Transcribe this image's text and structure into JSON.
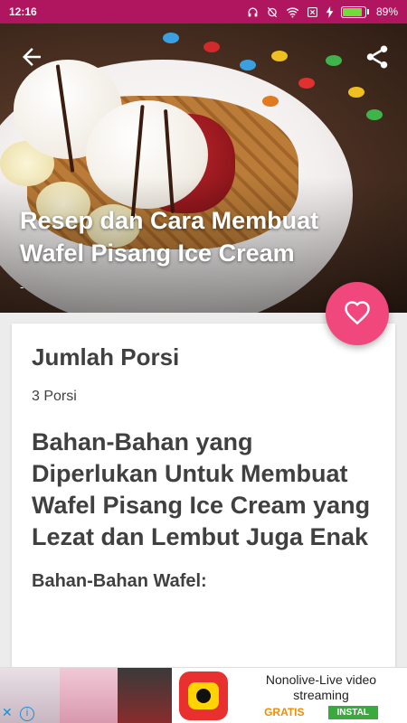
{
  "status_bar": {
    "time": "12:16",
    "battery_percent": "89%",
    "battery_level": 0.89,
    "icons": [
      "headset-icon",
      "alarm-off-icon",
      "wifi-icon",
      "sim-blocked-icon",
      "charging-icon"
    ]
  },
  "hero": {
    "title": "Resep dan Cara Membuat Wafel Pisang Ice Cream",
    "subtitle": "-",
    "back_icon": "arrow-back-icon",
    "share_icon": "share-icon"
  },
  "favorite_icon": "heart-outline-icon",
  "content": {
    "portion_heading": "Jumlah Porsi",
    "portion_value": "3 Porsi",
    "ingredients_heading": "Bahan-Bahan yang Diperlukan Untuk Membuat Wafel Pisang Ice Cream yang Lezat dan Lembut Juga Enak",
    "waffle_heading": "Bahan-Bahan Wafel:"
  },
  "ad": {
    "app_name": "Nonolive-Live video streaming",
    "price": "GRATIS",
    "install_label": "INSTAL",
    "close_symbol": "✕",
    "info_symbol": "i"
  },
  "colors": {
    "status_bar": "#b0165f",
    "fab": "#f0477c",
    "install": "#3aaa3e",
    "price": "#f28d00"
  }
}
